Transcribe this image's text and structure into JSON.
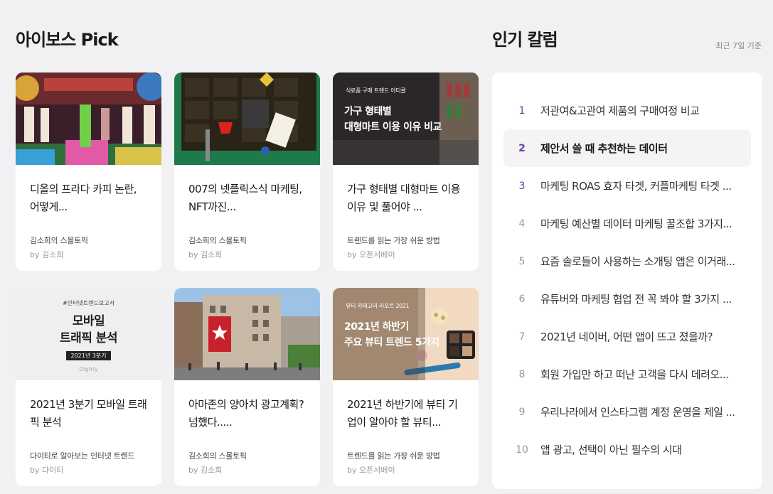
{
  "pick": {
    "title": "아이보스 Pick",
    "cards": [
      {
        "title": "디올의 프라다 카피 논란, 어떻게...",
        "source": "김소희의 스몰토픽",
        "author": "by 김소희"
      },
      {
        "title": "007의 넷플릭스식 마케팅, NFT까진...",
        "source": "김소희의 스몰토픽",
        "author": "by 김소희"
      },
      {
        "title": "가구 형태별 대형마트 이용 이유 및 풀어야 ...",
        "source": "트렌드를 읽는 가장 쉬운 방법",
        "author": "by 오픈서베이",
        "kicker": "식료품 구매 트렌드 아티클",
        "caption_line1": "가구 형태별",
        "caption_line2": "대형마트 이용 이유 비교"
      },
      {
        "title": "2021년 3분기 모바일 트래픽 분석",
        "source": "다이티로 알아보는 인터넷 트렌드",
        "author": "by 다이티",
        "kicker": "#인터넷트렌드보고서",
        "caption_line1": "모바일",
        "caption_line2": "트래픽 분석",
        "badge": "2021년 3분기",
        "brand": "Dighty"
      },
      {
        "title": "아마존의 양아치 광고계획? 넘했다.....",
        "source": "김소희의 스몰토픽",
        "author": "by 김소희"
      },
      {
        "title": "2021년 하반기에 뷰티 기업이 알아야 할 뷰티...",
        "source": "트렌드를 읽는 가장 쉬운 방법",
        "author": "by 오픈서베이",
        "kicker": "뷰티 카테고리 리포트 2021",
        "caption_line1": "2021년 하반기",
        "caption_line2": "주요 뷰티 트렌드 5가지"
      }
    ]
  },
  "popular": {
    "title": "인기 칼럼",
    "subtitle": "최근 7일 기준",
    "items": [
      {
        "rank": "1",
        "text": "저관여&고관여 제품의 구매여정 비교"
      },
      {
        "rank": "2",
        "text": "제안서 쓸 때 추천하는 데이터"
      },
      {
        "rank": "3",
        "text": "마케팅 ROAS 효자 타겟, 커플마케팅 타겟 ..."
      },
      {
        "rank": "4",
        "text": "마케팅 예산별 데이터 마케팅 꿀조합 3가지..."
      },
      {
        "rank": "5",
        "text": "요즘 솔로들이 사용하는 소개팅 앱은 이거래..."
      },
      {
        "rank": "6",
        "text": "유튜버와 마케팅 협업 전 꼭 봐야 할 3가지 ..."
      },
      {
        "rank": "7",
        "text": "2021년 네이버, 어떤 앱이 뜨고 졌을까?"
      },
      {
        "rank": "8",
        "text": "회원 가입만 하고 떠난 고객을 다시 데려오..."
      },
      {
        "rank": "9",
        "text": "우리나라에서 인스타그램 계정 운영을 제일 ..."
      },
      {
        "rank": "10",
        "text": "앱 광고, 선택이 아닌 필수의 시대"
      }
    ]
  },
  "colors": {
    "background": "#f1f1f3",
    "card": "#ffffff",
    "rank_accent": "#6b3fa0",
    "muted_text": "#999999"
  }
}
